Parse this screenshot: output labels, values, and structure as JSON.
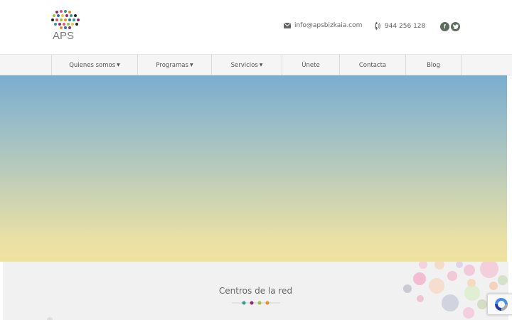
{
  "header": {
    "logo_text": "APS",
    "email": "info@apsbizkaia.com",
    "phone": "944 256 128",
    "social": [
      {
        "icon": "facebook-icon",
        "glyph": "f"
      },
      {
        "icon": "twitter-icon",
        "glyph": "t"
      }
    ]
  },
  "nav": {
    "items": [
      {
        "label": "Quienes somos",
        "dropdown": true
      },
      {
        "label": "Programas",
        "dropdown": true
      },
      {
        "label": "Servicios",
        "dropdown": true
      },
      {
        "label": "Únete",
        "dropdown": false
      },
      {
        "label": "Contacta",
        "dropdown": false
      },
      {
        "label": "Blog",
        "dropdown": false
      }
    ]
  },
  "section": {
    "title": "Centros de la red"
  },
  "colors": {
    "nav_background": "#f5f5f5",
    "hero_top": "#7aaecf",
    "hero_bottom": "#efe1a0",
    "divider_dots": [
      "#2a9d8f",
      "#8e2a6e",
      "#9bc53d",
      "#f08a24"
    ]
  }
}
